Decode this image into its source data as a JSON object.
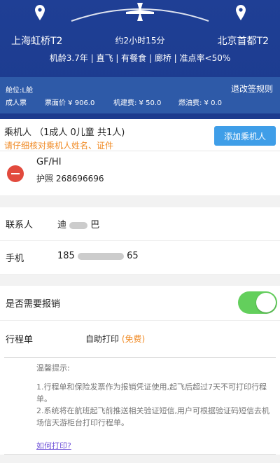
{
  "header": {
    "departure_city": "上海虹桥T2",
    "arrival_city": "北京首都T2",
    "duration": "约2小时15分",
    "info": "机龄3.7年 | 直飞 | 有餐食 | 廊桥 | 准点率<50%",
    "colors": {
      "header_bg": "#1f3f95",
      "fare_bg": "#2e5aa8",
      "accent": "#3f9ee8"
    },
    "icons": {
      "left_pin": "location-pin-icon",
      "airplane": "airplane-icon",
      "right_pin": "location-pin-icon"
    }
  },
  "fare": {
    "cabin": "舱位:L舱",
    "rules": "退改签规则",
    "adult_ticket": "成人票",
    "ticket_price": "票面价 ¥ 906.0",
    "airport_fee": "机建费: ¥ 50.0",
    "fuel_fee": "燃油费: ¥ 0.0"
  },
  "passenger": {
    "title": "乘机人 （1成人 0儿童 共1人)",
    "hint": "请仔细核对乘机人姓名、证件",
    "add_label": "添加乘机人",
    "entries": [
      {
        "name": "GF/HI",
        "id": "护照 268696696"
      }
    ]
  },
  "contact": {
    "contact_label": "联系人",
    "contact_name_prefix": "迪",
    "contact_name_suffix": "巴",
    "phone_label": "手机",
    "phone_prefix": "185",
    "phone_suffix": "65"
  },
  "reimburse": {
    "label": "是否需要报销",
    "enabled": true
  },
  "itinerary": {
    "label": "行程单",
    "option": "自助打印",
    "free": "(免费)"
  },
  "tips": {
    "title": "温馨提示:",
    "text_1": "1.行程单和保险发票作为报销凭证使用,起飞后超过7天不可打印行程单。",
    "text_2": "2.系统将在航班起飞前推送相关验证短信,用户可根据验证码短信去机场信天游柜台打印行程单。",
    "link": "如何打印?"
  }
}
